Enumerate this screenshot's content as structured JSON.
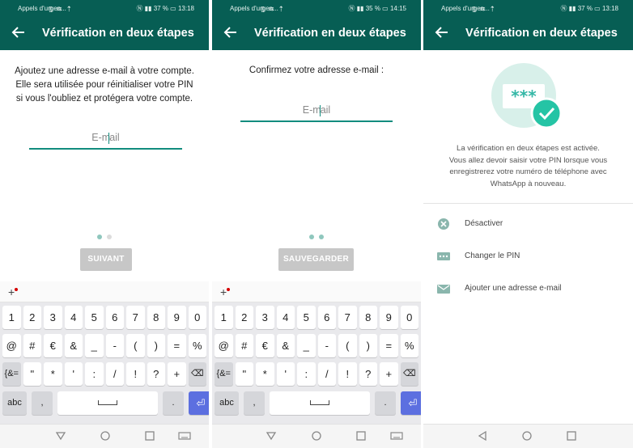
{
  "colors": {
    "header": "#075e54",
    "accent": "#128c7e",
    "dot_active": "#8fc7bd",
    "dot_inactive": "#dcdcdc",
    "button_disabled": "#c7c7c7"
  },
  "screens": [
    {
      "status": {
        "carrier": "Appels d'urgen...",
        "battery": "37 %",
        "time": "13:18"
      },
      "title": "Vérification en deux étapes",
      "description": [
        "Ajoutez une adresse e-mail à votre compte.",
        "Elle sera utilisée pour réinitialiser votre PIN",
        "si vous l'oubliez et protégera votre compte."
      ],
      "email_placeholder": "E-mail",
      "page_indicator": {
        "count": 2,
        "active": 1
      },
      "button": "SUIVANT"
    },
    {
      "status": {
        "carrier": "Appels d'urgen...",
        "battery": "35 %",
        "time": "14:15"
      },
      "title": "Vérification en deux étapes",
      "description": [
        "Confirmez votre adresse e-mail :"
      ],
      "email_placeholder": "E-mail",
      "page_indicator": {
        "count": 2,
        "active": 2
      },
      "button": "SAUVEGARDER"
    },
    {
      "status": {
        "carrier": "Appels d'urgen...",
        "battery": "37 %",
        "time": "13:18"
      },
      "title": "Vérification en deux étapes",
      "pin_graphic": "***",
      "description": [
        "La vérification en deux étapes est activée.",
        "Vous allez devoir saisir votre PIN lorsque vous",
        "enregistrerez votre numéro de téléphone avec",
        "WhatsApp à nouveau."
      ],
      "options": [
        {
          "label": "Désactiver",
          "icon": "close-circle-icon"
        },
        {
          "label": "Changer le PIN",
          "icon": "pin-dots-icon"
        },
        {
          "label": "Ajouter une adresse e-mail",
          "icon": "mail-icon"
        }
      ]
    }
  ],
  "keyboard": {
    "rows": [
      [
        "1",
        "2",
        "3",
        "4",
        "5",
        "6",
        "7",
        "8",
        "9",
        "0"
      ],
      [
        "@",
        "#",
        "€",
        "&",
        "_",
        "-",
        "(",
        ")",
        "=",
        "%"
      ],
      [
        "{&=",
        "\"",
        "*",
        "'",
        ":",
        "/",
        "!",
        "?",
        "+",
        "⌫"
      ],
      [
        "abc",
        ",",
        "␣",
        ".",
        "⏎"
      ]
    ]
  }
}
